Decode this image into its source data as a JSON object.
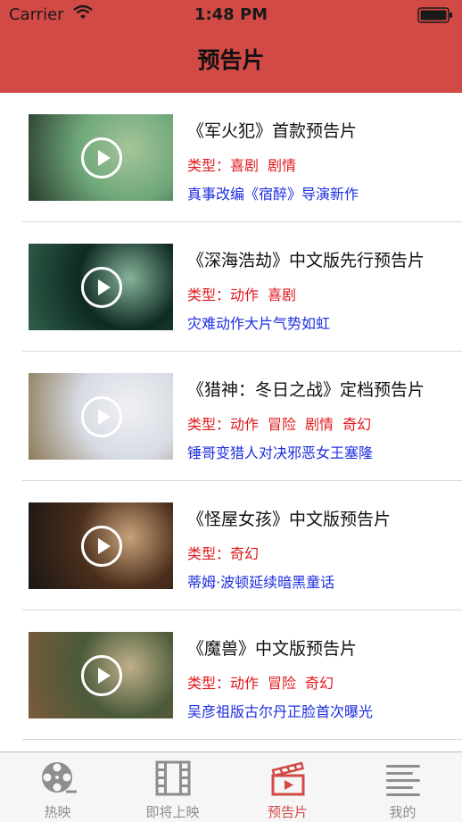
{
  "status_bar": {
    "carrier": "Carrier",
    "time": "1:48 PM"
  },
  "nav": {
    "title": "预告片"
  },
  "colors": {
    "accent": "#d24a46",
    "genre_text": "#e0191d",
    "desc_text": "#1d2ee0",
    "tab_inactive": "#8e8e8e"
  },
  "trailers": [
    {
      "title": "《军火犯》首款预告片",
      "genre_label": "类型：",
      "genres": [
        "喜剧",
        "剧情"
      ],
      "description": "真事改编《宿醉》导演新作",
      "thumb_colors": [
        "#6fa87a",
        "#2a3b2c",
        "#a6c59a"
      ]
    },
    {
      "title": "《深海浩劫》中文版先行预告片",
      "genre_label": "类型：",
      "genres": [
        "动作",
        "喜剧"
      ],
      "description": "灾难动作大片气势如虹",
      "thumb_colors": [
        "#0f2a22",
        "#2f5f4a",
        "#86b39a"
      ]
    },
    {
      "title": "《猎神：冬日之战》定档预告片",
      "genre_label": "类型：",
      "genres": [
        "动作",
        "冒险",
        "剧情",
        "奇幻"
      ],
      "description": "锤哥变猎人对决邪恶女王塞隆",
      "thumb_colors": [
        "#d7dbe3",
        "#8c7a58",
        "#f0f1f4"
      ]
    },
    {
      "title": "《怪屋女孩》中文版预告片",
      "genre_label": "类型：",
      "genres": [
        "奇幻"
      ],
      "description": "蒂姆·波顿延续暗黑童话",
      "thumb_colors": [
        "#4a2e1c",
        "#1a1614",
        "#c9a27a"
      ]
    },
    {
      "title": "《魔兽》中文版预告片",
      "genre_label": "类型：",
      "genres": [
        "动作",
        "冒险",
        "奇幻"
      ],
      "description": "吴彦祖版古尔丹正脸首次曝光",
      "thumb_colors": [
        "#4a5a3a",
        "#7a5a3a",
        "#c0b08a"
      ]
    }
  ],
  "tabbar": {
    "tabs": [
      {
        "label": "热映",
        "icon": "film-reel-icon",
        "active": false
      },
      {
        "label": "即将上映",
        "icon": "film-strip-icon",
        "active": false
      },
      {
        "label": "预告片",
        "icon": "clapperboard-icon",
        "active": true
      },
      {
        "label": "我的",
        "icon": "menu-lines-icon",
        "active": false
      }
    ]
  }
}
